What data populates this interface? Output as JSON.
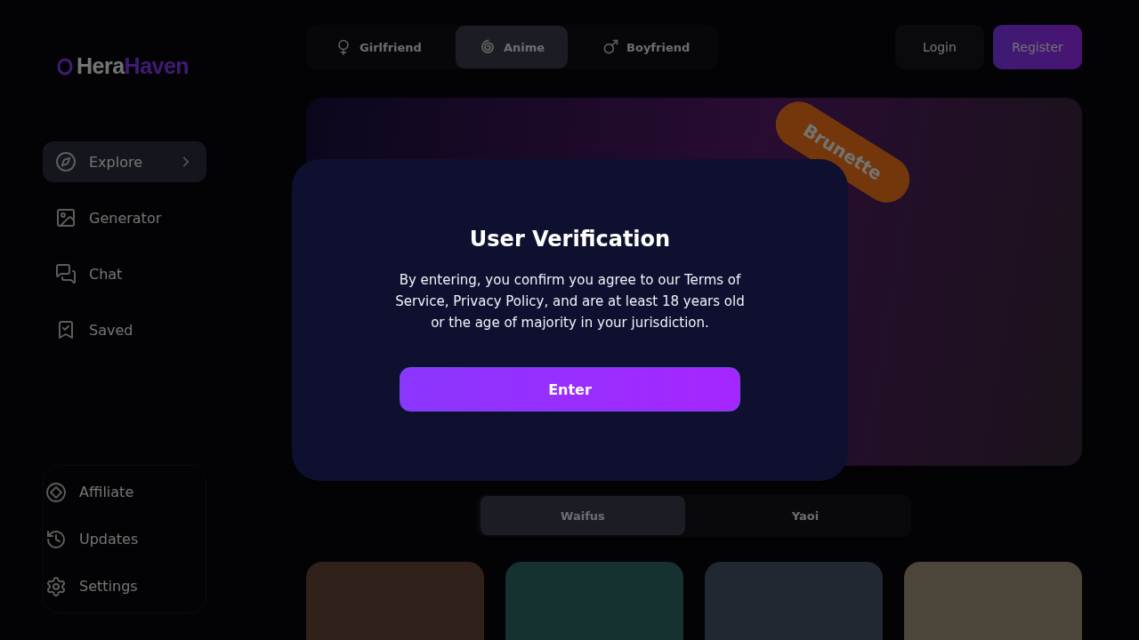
{
  "logo": {
    "part_1": "Hera",
    "part_2": "Haven"
  },
  "sidebar": {
    "items": [
      {
        "label": "Explore",
        "selected": true
      },
      {
        "label": "Generator",
        "selected": false
      },
      {
        "label": "Chat",
        "selected": false
      },
      {
        "label": "Saved",
        "selected": false
      }
    ],
    "footer_items": [
      {
        "label": "Affiliate"
      },
      {
        "label": "Updates"
      },
      {
        "label": "Settings"
      }
    ]
  },
  "category_tabs": [
    {
      "label": "Girlfriend",
      "selected": false
    },
    {
      "label": "Anime",
      "selected": true
    },
    {
      "label": "Boyfriend",
      "selected": false
    }
  ],
  "auth_buttons": {
    "login": "Login",
    "register": "Register"
  },
  "banner": {
    "tag": "Brunette"
  },
  "sub_tabs": [
    {
      "label": "Waifus",
      "selected": true
    },
    {
      "label": "Yaoi",
      "selected": false
    }
  ],
  "modal": {
    "title": "User Verification",
    "text": "By entering, you confirm you agree to our Terms of Service, Privacy Policy, and are at least 18 years old or the age of majority in your jurisdiction.",
    "button": "Enter"
  }
}
